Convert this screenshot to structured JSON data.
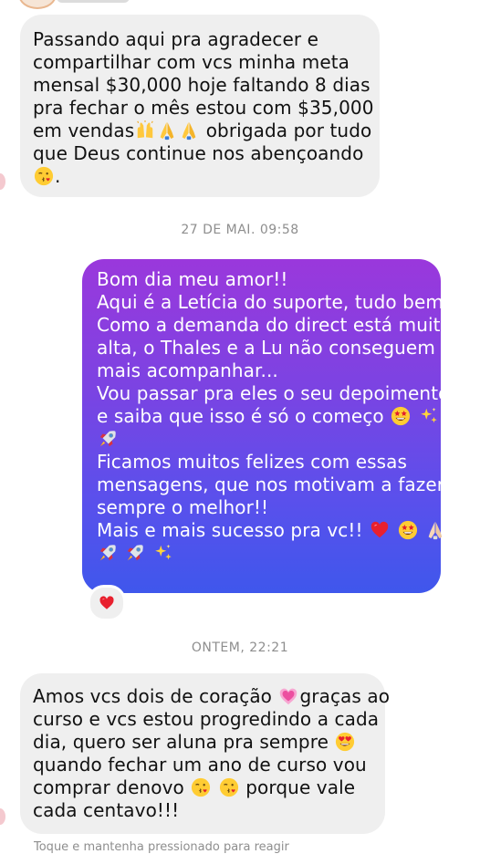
{
  "messages": [
    {
      "direction": "received",
      "lines": [
        "Passando aqui pra agradecer e",
        "compartilhar com vcs minha meta",
        "mensal $30,000 hoje faltando 8 dias",
        "pra fechar o mês estou com $35,000",
        "em vendas",
        "obrigada por tudo",
        "que Deus continue nos abençoando",
        "."
      ]
    },
    {
      "direction": "sent",
      "lines": [
        "Bom dia meu amor!!",
        "Aqui é a Letícia do suporte, tudo bem?!",
        "Como a demanda do direct está muito",
        "alta, o Thales e a Lu não conseguem",
        "mais acompanhar...",
        "Vou passar pra eles o seu depoimento,",
        "e saiba que isso é só o começo",
        "Ficamos muitos felizes com essas",
        "mensagens, que nos motivam a fazer",
        "sempre o melhor!!",
        "Mais e mais sucesso pra vc!!"
      ],
      "reaction": "red-heart"
    },
    {
      "direction": "received",
      "lines": [
        "Amos vcs dois de coração",
        "graças ao",
        "curso e vcs estou progredindo a cada",
        "dia, quero ser aluna pra sempre",
        "quando fechar um ano de curso vou",
        "comprar denovo",
        "porque vale",
        "cada centavo!!!"
      ]
    }
  ],
  "timestamps": [
    "27 DE MAI. 09:58",
    "ONTEM, 22:21"
  ],
  "hint": "Toque e mantenha pressionado para reagir",
  "colors": {
    "received_bubble": "#efefef",
    "sent_gradient_top": "#9a38dc",
    "sent_gradient_bottom": "#3f57ec",
    "meta_text": "#8e8e8e"
  },
  "emoji_names": {
    "kiss": "face-blowing-kiss-icon",
    "raised_hands": "raising-hands-icon",
    "folded_hands": "folded-hands-icon",
    "star_struck": "star-struck-icon",
    "sparkles": "sparkles-icon",
    "rocket": "rocket-icon",
    "red_heart": "red-heart-icon",
    "growing_heart": "growing-heart-icon",
    "heart_eyes": "heart-eyes-icon"
  }
}
